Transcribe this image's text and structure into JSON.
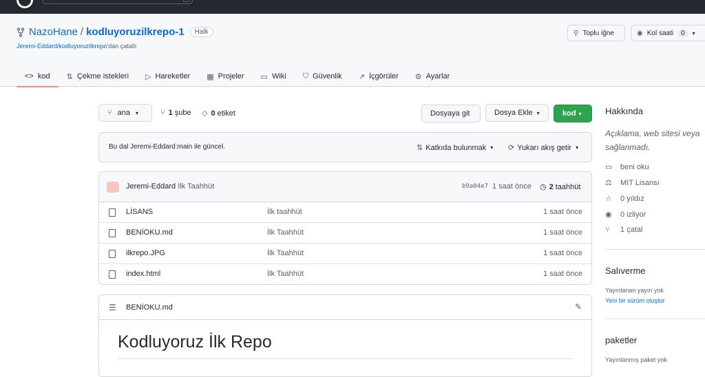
{
  "repo": {
    "owner": "NazoHane",
    "separator": "/",
    "name": "kodluyoruzilkrepo-1",
    "visibility": "Halk",
    "forked_from_link": "Jeremi-Eddard/kodluyoruzilkrepo",
    "forked_from_suffix": "'dan çatallı"
  },
  "header_buttons": {
    "pin": "Toplu iğne",
    "watch": "Kol saati",
    "watch_count": "0"
  },
  "tabs": [
    {
      "label": "kod",
      "icon": "code-icon",
      "glyph": "<>"
    },
    {
      "label": "Çekme istekleri",
      "icon": "pull-request-icon",
      "glyph": "⇅"
    },
    {
      "label": "Hareketler",
      "icon": "play-icon",
      "glyph": "▷"
    },
    {
      "label": "Projeler",
      "icon": "table-icon",
      "glyph": "▦"
    },
    {
      "label": "Wiki",
      "icon": "book-icon",
      "glyph": "▭"
    },
    {
      "label": "Güvenlik",
      "icon": "shield-icon",
      "glyph": "⛉"
    },
    {
      "label": "İçgörüler",
      "icon": "graph-icon",
      "glyph": "↗"
    },
    {
      "label": "Ayarlar",
      "icon": "gear-icon",
      "glyph": "⚙"
    }
  ],
  "toolbar": {
    "branch": "ana",
    "branches_count": "1",
    "branches_label": "şube",
    "tags_count": "0",
    "tags_label": "etiket",
    "goto_file": "Dosyaya git",
    "add_file": "Dosya Ekle",
    "code": "kod"
  },
  "branch_status": {
    "message": "Bu dal Jeremi-Eddard:main ile güncel.",
    "contribute": "Katkıda bulunmak",
    "fetch_upstream": "Yukarı akış getir"
  },
  "commit": {
    "author": "Jeremi-Eddard",
    "message": "İlk Taahhüt",
    "sha": "b9a04e7",
    "time": "1 saat önce",
    "history_count": "2",
    "history_label": "taahhüt"
  },
  "files": [
    {
      "name": "LİSANS",
      "message": "İlk taahhüt",
      "time": "1 saat önce"
    },
    {
      "name": "BENİOKU.md",
      "message": "İlk Taahhüt",
      "time": "1 saat önce"
    },
    {
      "name": "ilkrepo.JPG",
      "message": "İlk Taahhüt",
      "time": "1 saat önce"
    },
    {
      "name": "index.html",
      "message": "İlk Taahhüt",
      "time": "1 saat önce"
    }
  ],
  "readme": {
    "filename": "BENİOKU.md",
    "heading": "Kodluyoruz İlk Repo"
  },
  "sidebar": {
    "about_title": "Hakkında",
    "description_line1": "Açıklama, web sitesi veya",
    "description_line2": "sağlanmadı.",
    "items": [
      {
        "label": "beni oku",
        "icon": "book-icon",
        "glyph": "▭"
      },
      {
        "label": "MIT Lisansı",
        "icon": "law-icon",
        "glyph": "⚖"
      },
      {
        "label": "0 yıldız",
        "icon": "star-icon",
        "glyph": "☆"
      },
      {
        "label": "0 izliyor",
        "icon": "eye-icon",
        "glyph": "◉"
      },
      {
        "label": "1 çatal",
        "icon": "fork-icon",
        "glyph": "⑂"
      }
    ],
    "releases_title": "Salıverme",
    "releases_none": "Yayınlanan yayın yok",
    "releases_create": "Yeni bir sürüm oluştur",
    "packages_title": "paketler",
    "packages_none": "Yayınlanmış paket yok"
  }
}
